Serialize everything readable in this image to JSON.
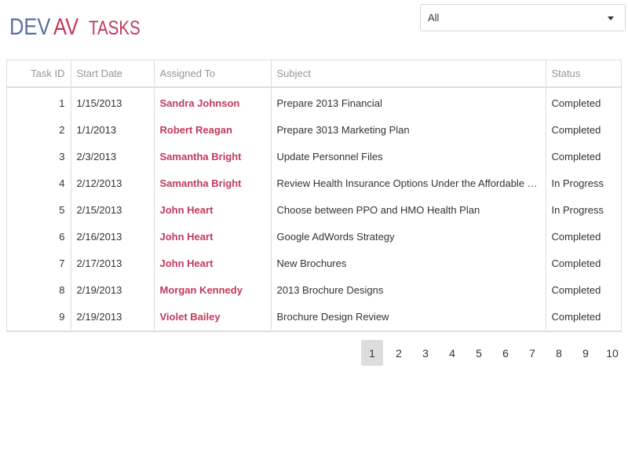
{
  "logo": {
    "part1": "DEV",
    "part2": "AV",
    "section": "TASKS"
  },
  "filter": {
    "selected": "All"
  },
  "columns": [
    "Task ID",
    "Start Date",
    "Assigned To",
    "Subject",
    "Status"
  ],
  "rows": [
    {
      "id": "1",
      "start": "1/15/2013",
      "assigned": "Sandra Johnson",
      "subject": "Prepare 2013 Financial",
      "status": "Completed"
    },
    {
      "id": "2",
      "start": "1/1/2013",
      "assigned": "Robert Reagan",
      "subject": "Prepare 3013 Marketing Plan",
      "status": "Completed"
    },
    {
      "id": "3",
      "start": "2/3/2013",
      "assigned": "Samantha Bright",
      "subject": "Update Personnel Files",
      "status": "Completed"
    },
    {
      "id": "4",
      "start": "2/12/2013",
      "assigned": "Samantha Bright",
      "subject": "Review Health Insurance Options Under the Affordable Care Act",
      "status": "In Progress"
    },
    {
      "id": "5",
      "start": "2/15/2013",
      "assigned": "John Heart",
      "subject": "Choose between PPO and HMO Health Plan",
      "status": "In Progress"
    },
    {
      "id": "6",
      "start": "2/16/2013",
      "assigned": "John Heart",
      "subject": "Google AdWords Strategy",
      "status": "Completed"
    },
    {
      "id": "7",
      "start": "2/17/2013",
      "assigned": "John Heart",
      "subject": "New Brochures",
      "status": "Completed"
    },
    {
      "id": "8",
      "start": "2/19/2013",
      "assigned": "Morgan Kennedy",
      "subject": "2013 Brochure Designs",
      "status": "Completed"
    },
    {
      "id": "9",
      "start": "2/19/2013",
      "assigned": "Violet Bailey",
      "subject": "Brochure Design Review",
      "status": "Completed"
    }
  ],
  "pager": {
    "pages": [
      "1",
      "2",
      "3",
      "4",
      "5",
      "6",
      "7",
      "8",
      "9",
      "10"
    ],
    "current": "1"
  },
  "colors": {
    "brand_blue": "#5b6ea3",
    "brand_red": "#c1395e",
    "selected_page_bg": "#dddddd"
  }
}
